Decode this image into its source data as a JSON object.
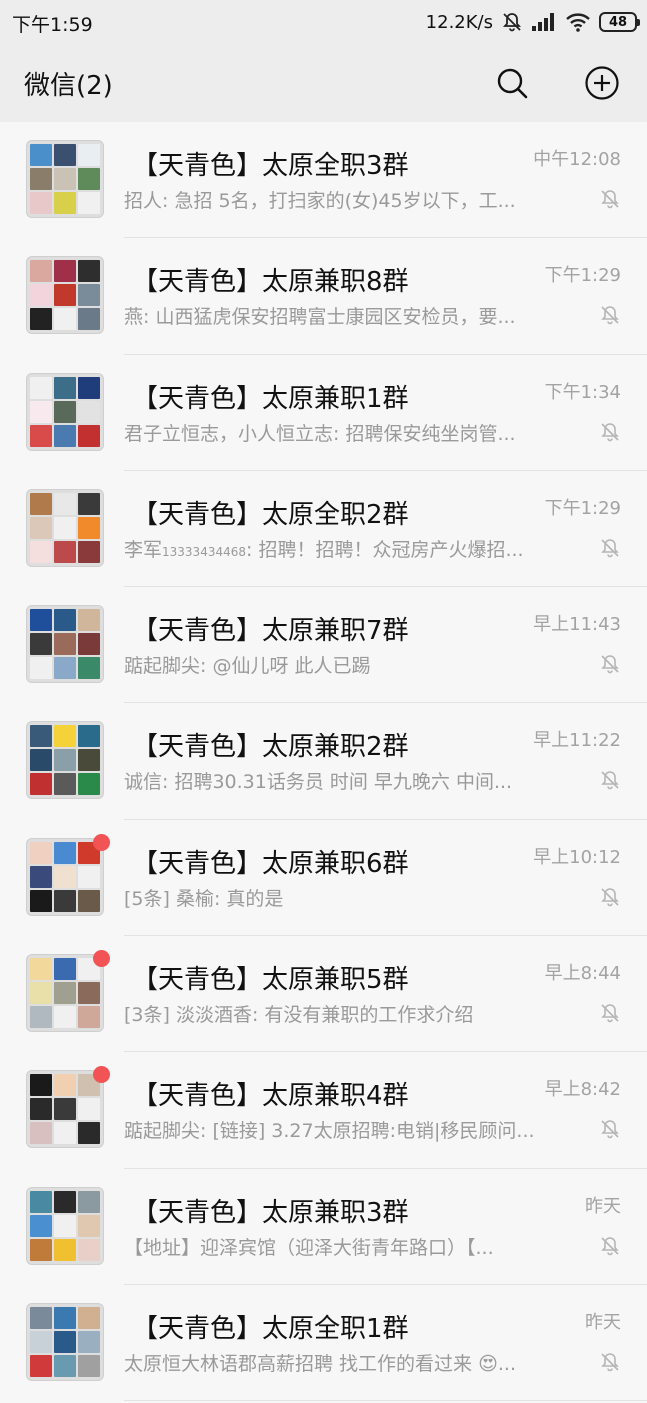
{
  "status_bar": {
    "time": "下午1:59",
    "net_speed": "12.2K/s",
    "battery": "48"
  },
  "header": {
    "title": "微信(2)"
  },
  "chats": [
    {
      "name": "【天青色】太原全职3群",
      "time": "中午12:08",
      "message": "招人: 急招 5名，打扫家的(女)45岁以下，工...",
      "unread": false,
      "avatar_colors": [
        "#4a8fc9",
        "#3b4f6e",
        "#e9eef3",
        "#8a7d6a",
        "#c9c2b5",
        "#5f8a5a",
        "#e8c8c8",
        "#d8d04a",
        "#f0f0f0"
      ]
    },
    {
      "name": "【天青色】太原兼职8群",
      "time": "下午1:29",
      "message": "燕: 山西猛虎保安招聘富士康园区安检员，要...",
      "unread": false,
      "avatar_colors": [
        "#d9a9a0",
        "#a0304a",
        "#2e2e2e",
        "#f3d4dc",
        "#c0392b",
        "#7a8c9a",
        "#222222",
        "#f0f0f0",
        "#6a7a88"
      ]
    },
    {
      "name": "【天青色】太原兼职1群",
      "time": "下午1:34",
      "message": "君子立恒志，小人恒立志: 招聘保安纯坐岗管...",
      "unread": false,
      "avatar_colors": [
        "#f0f0f0",
        "#3c6e8a",
        "#1f3d7a",
        "#f7e9ee",
        "#5a6a5a",
        "#e2e2e2",
        "#d94b4b",
        "#4a7ab0",
        "#c23030"
      ]
    },
    {
      "name": "【天青色】太原全职2群",
      "time": "下午1:29",
      "message": "李军",
      "message_sub": "13333434468",
      "message_tail": ": 招聘！招聘！众冠房产火爆招...",
      "unread": false,
      "avatar_colors": [
        "#b07a4a",
        "#e8e8e8",
        "#3a3a3a",
        "#dcc8b8",
        "#f0f0f0",
        "#f08a2a",
        "#f4dede",
        "#bd4a4a",
        "#8a3a3a"
      ]
    },
    {
      "name": "【天青色】太原兼职7群",
      "time": "早上11:43",
      "message": "踮起脚尖: @仙儿呀 此人已踢",
      "unread": false,
      "avatar_colors": [
        "#1f4f9a",
        "#2a5a8a",
        "#d0b69a",
        "#3a3a3a",
        "#9a6a5a",
        "#7a3a3a",
        "#f0f0f0",
        "#8aa9c9",
        "#3a8a6a"
      ]
    },
    {
      "name": "【天青色】太原兼职2群",
      "time": "早上11:22",
      "message": "诚信: 招聘30.31话务员  时间 早九晚六  中间...",
      "unread": false,
      "avatar_colors": [
        "#3a5a7a",
        "#f5d23a",
        "#2a6a8a",
        "#2a4a6a",
        "#8aa0a8",
        "#4a4a3a",
        "#c03030",
        "#5a5a5a",
        "#2a8a4a"
      ]
    },
    {
      "name": "【天青色】太原兼职6群",
      "time": "早上10:12",
      "message": "[5条] 桑榆: 真的是",
      "unread": true,
      "avatar_colors": [
        "#f0d0c0",
        "#4a8ad0",
        "#d03a2a",
        "#3a4a7a",
        "#f0e0d0",
        "#f0f0f0",
        "#1a1a1a",
        "#3a3a3a",
        "#6a5a4a"
      ]
    },
    {
      "name": "【天青色】太原兼职5群",
      "time": "早上8:44",
      "message": "[3条] 淡淡酒香: 有没有兼职的工作求介绍",
      "unread": true,
      "avatar_colors": [
        "#f2d89a",
        "#3a6ab0",
        "#f0f0f0",
        "#e8e0a8",
        "#a0a090",
        "#8a6a5a",
        "#b0b8c0",
        "#f0f0f0",
        "#d0a89a"
      ]
    },
    {
      "name": "【天青色】太原兼职4群",
      "time": "早上8:42",
      "message": "踮起脚尖: [链接] 3.27太原招聘:电销|移民顾问...",
      "unread": true,
      "avatar_colors": [
        "#1a1a1a",
        "#f0d0b0",
        "#d0c0b0",
        "#2a2a2a",
        "#3a3a3a",
        "#f0f0f0",
        "#d8c0c0",
        "#f0f0f0",
        "#2a2a2a"
      ]
    },
    {
      "name": "【天青色】太原兼职3群",
      "time": "昨天",
      "message": "【地址】迎泽宾馆（迎泽大街青年路口）【...",
      "unread": false,
      "avatar_colors": [
        "#4a8aa0",
        "#2a2a2a",
        "#8a9aa0",
        "#4a90d0",
        "#f0f0f0",
        "#e0c8b0",
        "#c07a3a",
        "#f0c030",
        "#e8d0c8"
      ]
    },
    {
      "name": "【天青色】太原全职1群",
      "time": "昨天",
      "message": "太原恒大林语郡高薪招聘 找工作的看过来 😍...",
      "unread": false,
      "avatar_colors": [
        "#7a8a9a",
        "#3a7ab0",
        "#d0b090",
        "#c8d0d8",
        "#2a5a8a",
        "#9ab0c0",
        "#d03a3a",
        "#6a9ab0",
        "#a0a0a0"
      ]
    }
  ]
}
